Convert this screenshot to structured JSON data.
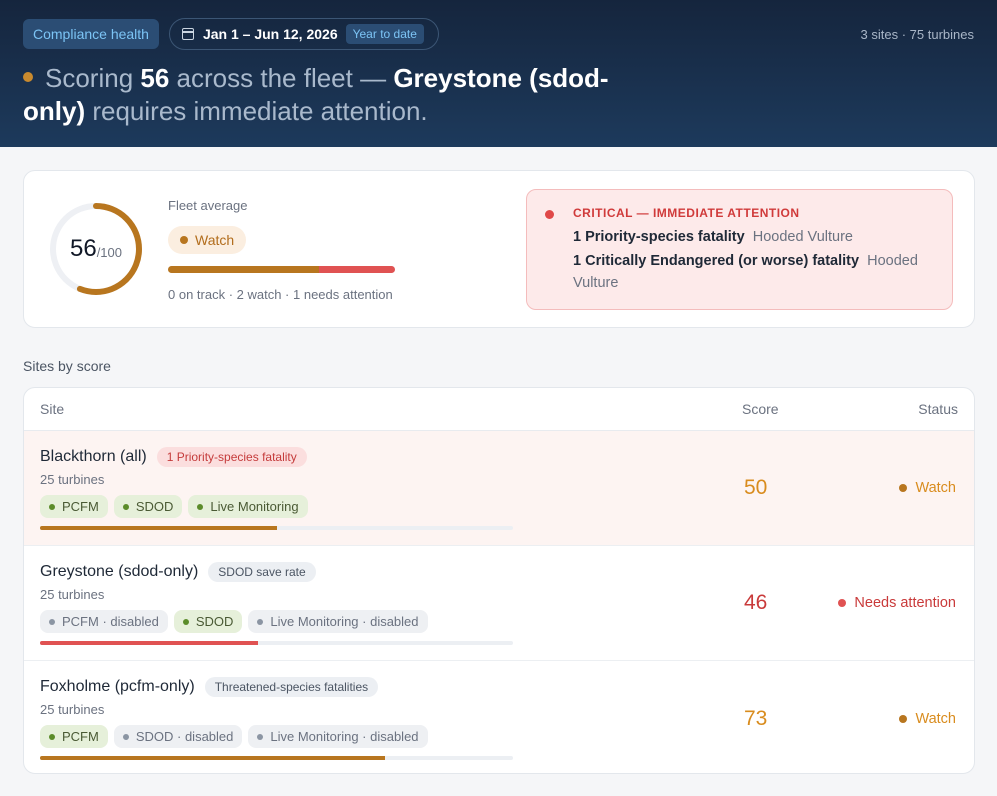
{
  "header": {
    "tag": "Compliance health",
    "date_range": "Jan 1 – Jun 12, 2026",
    "period_badge": "Year to date",
    "meta": "3 sites · 75 turbines",
    "headline_prefix": "Scoring",
    "headline_score": "56",
    "headline_mid": "across the fleet —",
    "headline_site": "Greystone (sdod-only)",
    "headline_suffix": "requires immediate attention."
  },
  "fleet": {
    "score": "56",
    "score_max": "/100",
    "score_fraction": 0.56,
    "label": "Fleet average",
    "status": "Watch",
    "counts": "0 on track · 2 watch · 1 needs attention",
    "distribution": {
      "on_track": 0,
      "watch": 2,
      "needs_attention": 1
    }
  },
  "alert": {
    "title": "CRITICAL — IMMEDIATE ATTENTION",
    "items": [
      {
        "label": "1 Priority-species fatality",
        "detail": "Hooded Vulture"
      },
      {
        "label": "1 Critically Endangered (or worse) fatality",
        "detail": "Hooded Vulture"
      }
    ]
  },
  "section_title": "Sites by score",
  "table": {
    "columns": {
      "site": "Site",
      "score": "Score",
      "status": "Status"
    },
    "rows": [
      {
        "name": "Blackthorn (all)",
        "tag": "1 Priority-species fatality",
        "turbines": "25 turbines",
        "chips": [
          {
            "label": "PCFM",
            "enabled": true
          },
          {
            "label": "SDOD",
            "enabled": true
          },
          {
            "label": "Live Monitoring",
            "enabled": true
          }
        ],
        "score": "50",
        "score_fraction": 0.5,
        "status": "Watch"
      },
      {
        "name": "Greystone (sdod-only)",
        "tag": "SDOD save rate",
        "turbines": "25 turbines",
        "chips": [
          {
            "label": "PCFM · disabled",
            "enabled": false
          },
          {
            "label": "SDOD",
            "enabled": true
          },
          {
            "label": "Live Monitoring · disabled",
            "enabled": false
          }
        ],
        "score": "46",
        "score_fraction": 0.46,
        "status": "Needs attention"
      },
      {
        "name": "Foxholme (pcfm-only)",
        "tag": "Threatened-species fatalities",
        "turbines": "25 turbines",
        "chips": [
          {
            "label": "PCFM",
            "enabled": true
          },
          {
            "label": "SDOD · disabled",
            "enabled": false
          },
          {
            "label": "Live Monitoring · disabled",
            "enabled": false
          }
        ],
        "score": "73",
        "score_fraction": 0.73,
        "status": "Watch"
      }
    ]
  },
  "colors": {
    "watch": "#b8761f",
    "watch_score": "#d98c1e",
    "needs_attention": "#e05252",
    "needs_score": "#c93a3a"
  }
}
